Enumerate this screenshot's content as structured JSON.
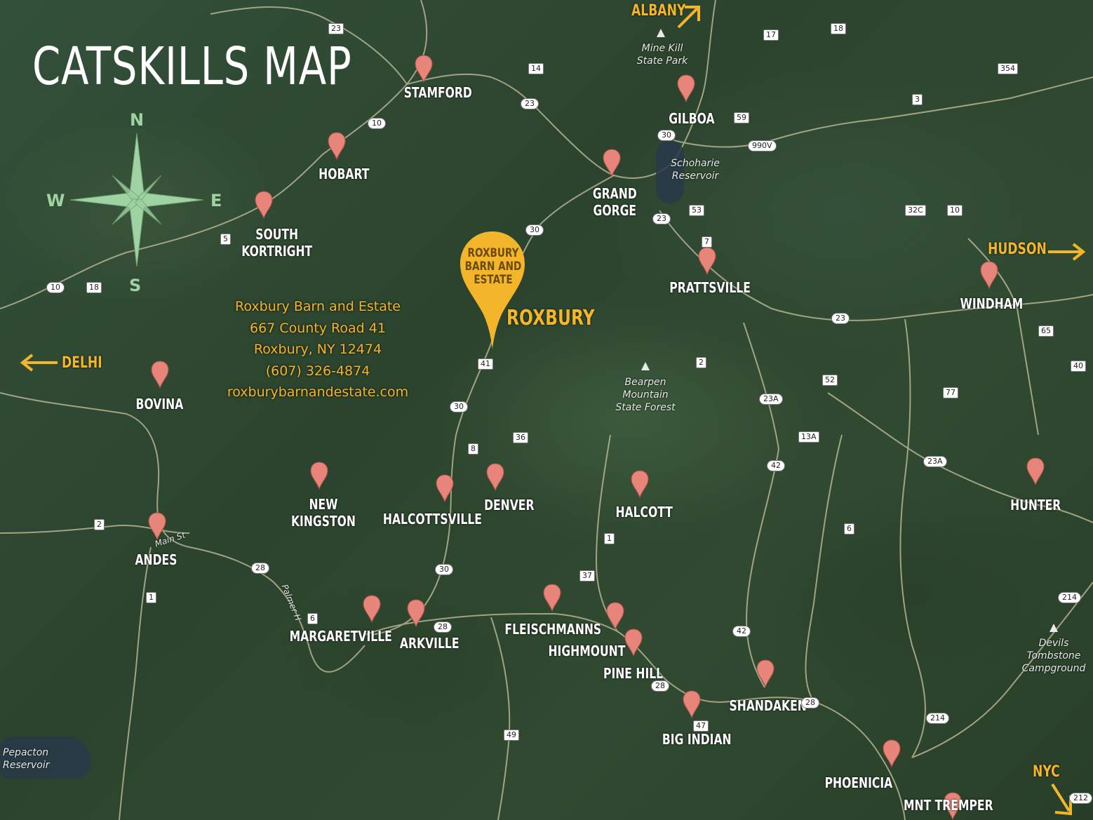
{
  "title": "CATSKILLS MAP",
  "compass": {
    "n": "N",
    "s": "S",
    "e": "E",
    "w": "W",
    "icon": "compass-rose-icon",
    "color": "#9fd3a3"
  },
  "featured": {
    "pin_text": "ROXBURY BARN AND ESTATE",
    "pin_lines": [
      "ROXBURY",
      "BARN AND",
      "ESTATE"
    ],
    "town": "ROXBURY",
    "color": "#f3b52a",
    "address": [
      "Roxbury Barn and Estate",
      "667 County Road 41",
      "Roxbury, NY 12474",
      "(607) 326-4874",
      "roxburybarnandestate.com"
    ]
  },
  "directions": {
    "albany": "ALBANY",
    "hudson": "HUDSON",
    "delhi": "DELHI",
    "nyc": "NYC"
  },
  "towns": {
    "stamford": "STAMFORD",
    "hobart": "HOBART",
    "south_kortright": "SOUTH\nKORTRIGHT",
    "gilboa": "GILBOA",
    "grand_gorge": "GRAND\nGORGE",
    "prattsville": "PRATTSVILLE",
    "windham": "WINDHAM",
    "bovina": "BOVINA",
    "new_kingston": "NEW\nKINGSTON",
    "halcottsville": "HALCOTTSVILLE",
    "denver": "DENVER",
    "halcott": "HALCOTT",
    "hunter": "HUNTER",
    "andes": "ANDES",
    "margaretville": "MARGARETVILLE",
    "arkville": "ARKVILLE",
    "fleischmanns": "FLEISCHMANNS",
    "highmount": "HIGHMOUNT",
    "pine_hill": "PINE HILL",
    "shandaken": "SHANDAKEN",
    "big_indian": "BIG INDIAN",
    "phoenicia": "PHOENICIA",
    "mnt_tremper": "MNT TREMPER"
  },
  "places": {
    "mine_kill": "Mine Kill\nState Park",
    "schoharie": "Schoharie\nReservoir",
    "bearpen": "Bearpen\nMountain\nState Forest",
    "devils": "Devils\nTombstone\nCampground",
    "pepacton": "Pepacton\nReservoir",
    "main_st": "Main St",
    "palmer": "Palmer H"
  },
  "routes": [
    "23",
    "14",
    "23",
    "10",
    "17",
    "18",
    "354",
    "3",
    "59",
    "990V",
    "30",
    "53",
    "23",
    "32C",
    "10",
    "7",
    "5",
    "10",
    "18",
    "30",
    "41",
    "23",
    "65",
    "2",
    "52",
    "23A",
    "77",
    "40",
    "30",
    "8",
    "36",
    "13A",
    "42",
    "23A",
    "2",
    "1",
    "6",
    "28",
    "1",
    "30",
    "37",
    "6",
    "28",
    "214",
    "42",
    "28",
    "28",
    "47",
    "214",
    "49",
    "212"
  ],
  "pin_color": "#e8857a"
}
